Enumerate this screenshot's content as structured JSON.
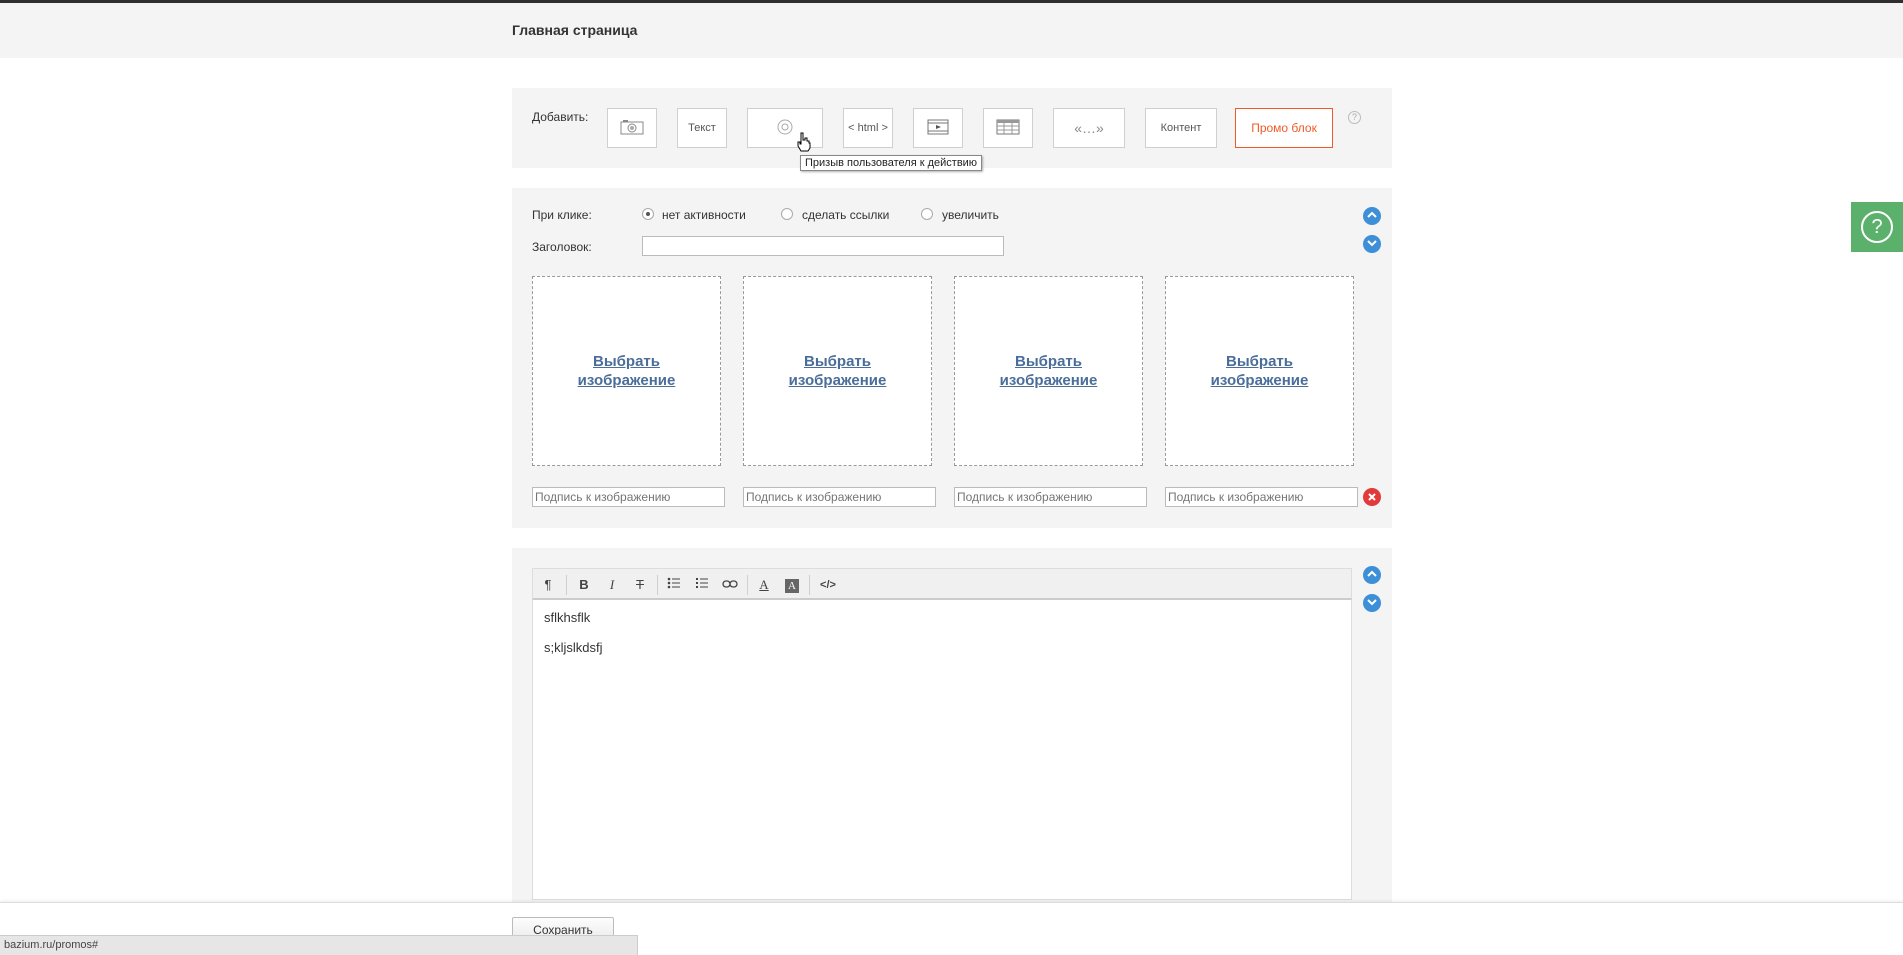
{
  "header": {
    "title": "Главная страница"
  },
  "toolbar": {
    "add_label": "Добавить:",
    "buttons": {
      "gallery_icon": "camera-icon",
      "text": "Текст",
      "cta_icon": "target-icon",
      "html": "< html >",
      "video_icon": "film-icon",
      "table_icon": "table-icon",
      "quote": "«…»",
      "content": "Контент",
      "promo": "Промо блок"
    },
    "help": "?",
    "tooltip": "Призыв пользователя к действию",
    "promo_color": "#f05a28"
  },
  "gallery": {
    "on_click_label": "При клике:",
    "options": [
      "нет активности",
      "сделать ссылки",
      "увеличить"
    ],
    "selected_option": "нет активности",
    "title_label": "Заголовок:",
    "title_value": "",
    "slot_label": "Выбрать изображение",
    "caption_placeholder": "Подпись к изображению"
  },
  "editor": {
    "toolbar": [
      "¶",
      "B",
      "I",
      "T",
      "list-bullets",
      "list-numbers",
      "link",
      "A",
      "A",
      "</>"
    ],
    "lines": [
      "sflkhsflk",
      "s;kljslkdsfj"
    ]
  },
  "footer": {
    "save_label": "Сохранить",
    "status_url": "bazium.ru/promos#"
  },
  "side_help": {
    "label": "?",
    "color": "#5bb16b"
  },
  "accent_blue": "#3d8fd8"
}
